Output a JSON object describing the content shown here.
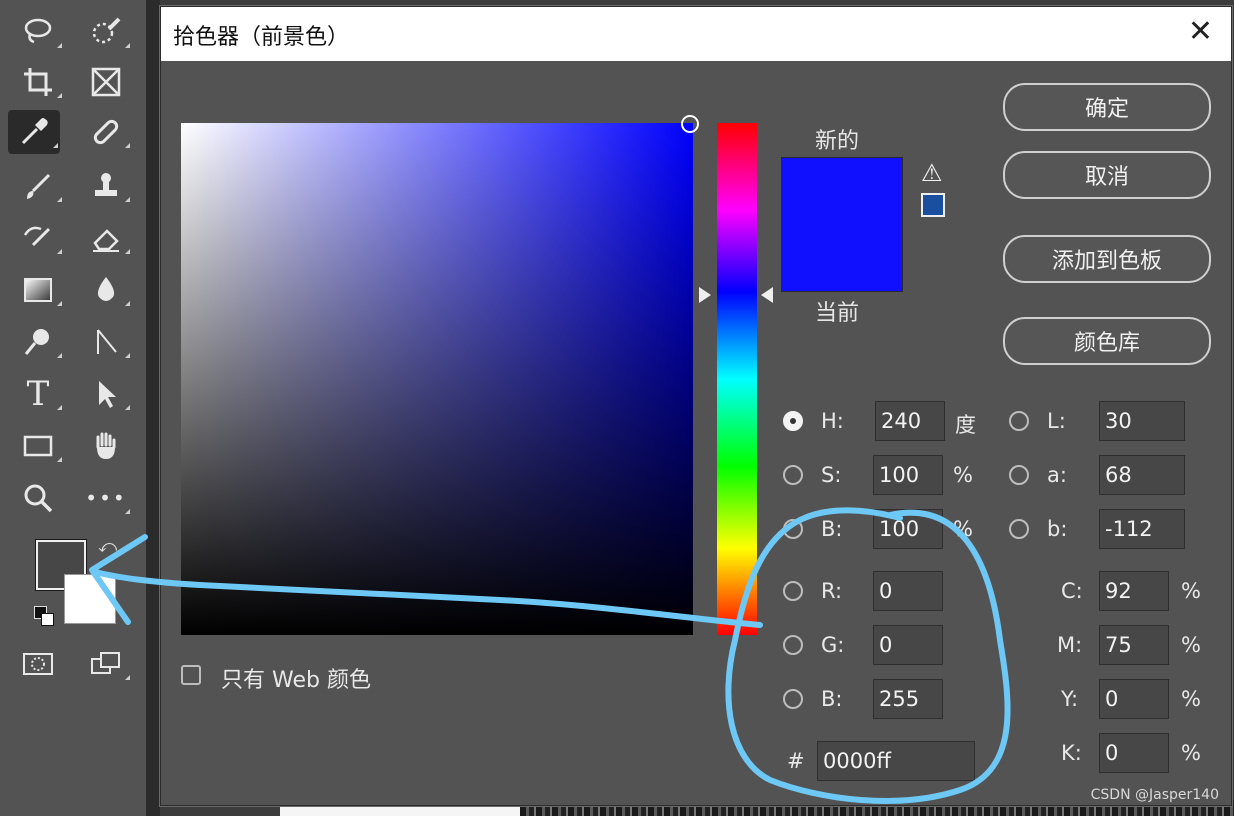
{
  "dialog": {
    "title": "拾色器（前景色）",
    "close_glyph": "✕",
    "new_label": "新的",
    "current_label": "当前",
    "new_color": "#1010ff",
    "current_color": "#1010ff",
    "web_only_label": "只有 Web 颜色",
    "buttons": {
      "ok": "确定",
      "cancel": "取消",
      "add_swatch": "添加到色板",
      "color_libraries": "颜色库"
    }
  },
  "fields": {
    "hsb": {
      "h": {
        "label": "H:",
        "value": "240",
        "unit": "度",
        "selected": true
      },
      "s": {
        "label": "S:",
        "value": "100",
        "unit": "%"
      },
      "b": {
        "label": "B:",
        "value": "100",
        "unit": "%"
      }
    },
    "rgb": {
      "r": {
        "label": "R:",
        "value": "0"
      },
      "g": {
        "label": "G:",
        "value": "0"
      },
      "b": {
        "label": "B:",
        "value": "255"
      }
    },
    "lab": {
      "l": {
        "label": "L:",
        "value": "30"
      },
      "a": {
        "label": "a:",
        "value": "68"
      },
      "b": {
        "label": "b:",
        "value": "-112"
      }
    },
    "cmyk": {
      "c": {
        "label": "C:",
        "value": "92",
        "unit": "%"
      },
      "m": {
        "label": "M:",
        "value": "75",
        "unit": "%"
      },
      "y": {
        "label": "Y:",
        "value": "0",
        "unit": "%"
      },
      "k": {
        "label": "K:",
        "value": "0",
        "unit": "%"
      }
    },
    "hex": {
      "label": "#",
      "value": "0000ff"
    }
  },
  "toolbar": {
    "foreground_color": "#474747",
    "background_color": "#ffffff",
    "tools": [
      "lasso-tool",
      "quick-selection-tool",
      "crop-tool",
      "frame-tool",
      "eyedropper-tool",
      "healing-brush-tool",
      "brush-tool",
      "clone-stamp-tool",
      "history-brush-tool",
      "eraser-tool",
      "gradient-tool",
      "blur-tool",
      "dodge-tool",
      "pen-tool",
      "type-tool",
      "path-selection-tool",
      "rectangle-tool",
      "hand-tool",
      "zoom-tool",
      "more-tools",
      "quick-mask",
      "screen-mode"
    ],
    "type_glyph": "T",
    "more_glyph": "•••"
  },
  "watermark": "CSDN @Jasper140",
  "annotation_color": "#6ec8f5"
}
